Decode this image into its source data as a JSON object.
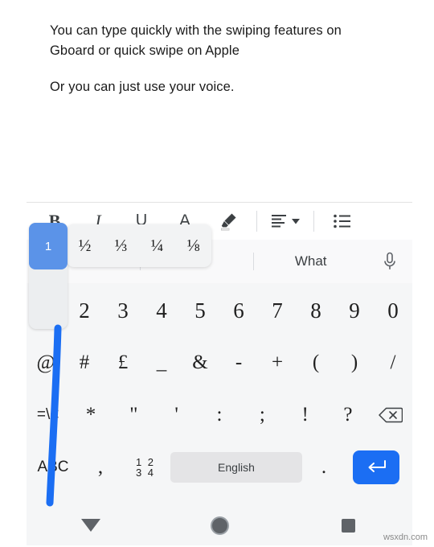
{
  "document": {
    "paragraphs": [
      "You can type quickly with the swiping features on Gboard or quick swipe on Apple",
      "Or you can just use your voice."
    ]
  },
  "toolbar": {
    "bold_label": "B",
    "italic_label": "I",
    "underline_label": "U",
    "text_color_label": "A",
    "highlight_icon": "highlighter-pen-icon",
    "align_icon": "align-left-icon",
    "align_dropdown_icon": "chevron-down-icon",
    "list_icon": "bulleted-list-icon"
  },
  "keyboard": {
    "suggestions": [
      {
        "label": "",
        "hidden_by_popup": true
      },
      {
        "label": "",
        "hidden_by_popup": true
      },
      {
        "label": "What",
        "hidden_by_popup": false
      }
    ],
    "mic_icon": "microphone-icon",
    "pressed_key": {
      "label": "1",
      "accent_color": "#5b93e8",
      "alternates": [
        "½",
        "⅓",
        "¼",
        "⅛"
      ]
    },
    "rows": {
      "numbers": [
        "1",
        "2",
        "3",
        "4",
        "5",
        "6",
        "7",
        "8",
        "9",
        "0"
      ],
      "symbols": [
        "@",
        "#",
        "£",
        "_",
        "&",
        "-",
        "+",
        "(",
        ")",
        "/"
      ],
      "punctuation": [
        "=\\<",
        "*",
        "\"",
        "'",
        ":",
        ";",
        "!",
        "?"
      ],
      "backspace_icon": "backspace-icon"
    },
    "bottom_row": {
      "abc_label": "ABC",
      "comma_label": ",",
      "numeric_key_label": "12\n34",
      "numeric_key_top": "1 2",
      "numeric_key_bottom": "3 4",
      "space_label": "English",
      "period_label": ".",
      "enter_icon": "enter-return-icon",
      "enter_color": "#1b6ef3"
    }
  },
  "annotation": {
    "stroke_color": "#1b6ef3",
    "stroke_name": "blue-vertical-swipe-stroke"
  },
  "navbar": {
    "back_icon": "hide-keyboard-triangle-icon",
    "home_icon": "home-circle-icon",
    "recents_icon": "recents-square-icon"
  },
  "watermark": {
    "text": "wsxdn.com"
  }
}
